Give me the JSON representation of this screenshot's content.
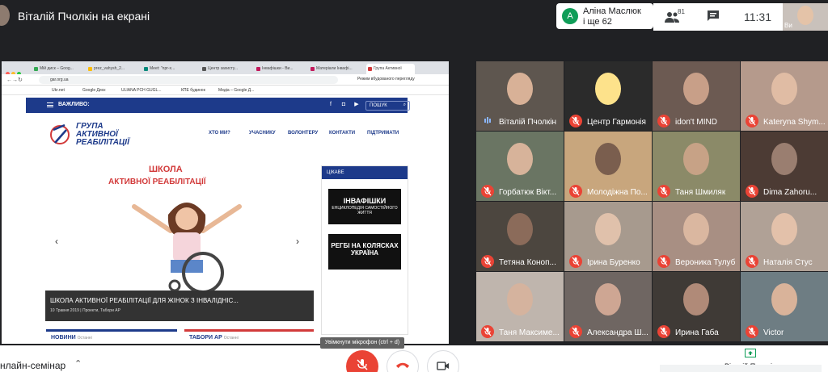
{
  "header": {
    "presenter_text": "Віталій Пчолкін на екрані"
  },
  "notification": {
    "avatar_letter": "A",
    "name": "Аліна Маслюк",
    "more": "і ще 62"
  },
  "controls": {
    "people_count": "81",
    "time": "11:31",
    "self_label": "Ви"
  },
  "browser": {
    "tabs": [
      "Мій диск – Goog...",
      "prez_vahysh_2...",
      "Meet: \"npr-x...",
      "Центр захисту...",
      "Інвафішки - Ви...",
      "Матеріали Інвафі...",
      "Група Активної"
    ],
    "url": "gar.org.ua",
    "reading_mode": "Режим вбудованого перегляду",
    "bookmarks": [
      "Ukr.net",
      "Google Диск",
      "ULIANA PCH GUGL...",
      "КПЕ будинок",
      "Медіа – Google Д..."
    ]
  },
  "site": {
    "important_label": "ВАЖЛИВО:",
    "search_label": "ПОШУК",
    "logo_line1": "ГРУПА",
    "logo_line2": "АКТИВНОЇ",
    "logo_line3": "РЕАБІЛІТАЦІЇ",
    "nav": [
      "ХТО МИ?",
      "УЧАСНИКУ",
      "ВОЛОНТЕРУ",
      "КОНТАКТИ",
      "ПІДТРИМАТИ"
    ],
    "slide_title1": "ШКОЛА",
    "slide_title2": "АКТИВНОЇ РЕАБІЛІТАЦІЇ",
    "caption_title": "ШКОЛА АКТИВНОЇ РЕАБІЛІТАЦІЇ ДЛЯ ЖІНОК З ІНВАЛІДНІС...",
    "caption_meta": "10 Травня 2019 | Проекти, Табори АР",
    "sidebar_head": "ЦІКАВЕ",
    "ad1_title": "ІНВАФІШКИ",
    "ad1_sub": "ЕНЦИКЛОПЕДІЯ САМОСТІЙНОГО ЖИТТЯ",
    "ad2_title": "РЕГБІ НА КОЛЯСКАХ УКРАЇНА",
    "news_tab": "НОВИНИ",
    "tabory_tab": "ТАБОРИ АР",
    "recent": "Останні"
  },
  "participants": [
    "Віталій Пчолкін",
    "Центр Гармонія",
    "idon't MIND",
    "Kateryna Shym...",
    "Горбатюк Вікт...",
    "Молодіжна По...",
    "Таня Шмиляк",
    "Dima Zahoru...",
    "Тетяна Коноп...",
    "Ірина Буренко",
    "Вероника Тулуб",
    "Наталія Стус",
    "Таня Максиме...",
    "Александра Ш...",
    "Ирина Габа",
    "Victor"
  ],
  "bottom": {
    "meeting_name": "нлайн-семінар",
    "tooltip": "Увімкнути мікрофон (ctrl + d)",
    "present_label": "Віталій Пчолкін"
  },
  "colors": {
    "accent_red": "#ea4335",
    "site_blue": "#1d3a8a",
    "bg_dark": "#202124"
  }
}
